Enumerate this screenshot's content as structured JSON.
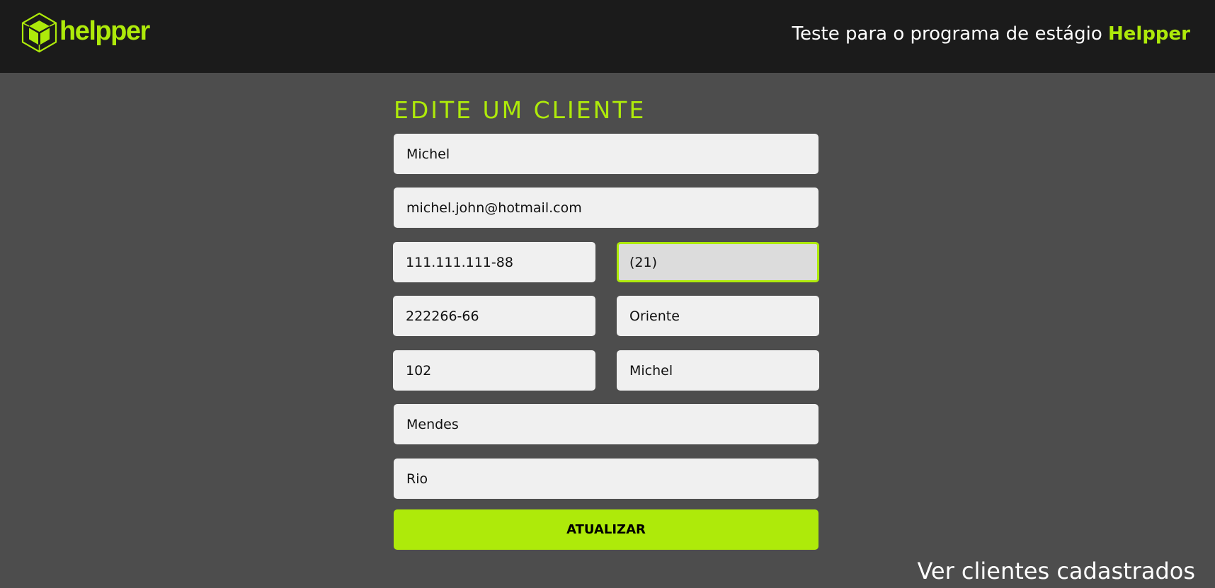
{
  "header": {
    "logo_text": "helpper",
    "logo_icon": "cube-icon",
    "tagline_prefix": "Teste para o programa de estágio ",
    "tagline_brand": "Helpper"
  },
  "form": {
    "title": "EDITE UM CLIENTE",
    "fields": {
      "name": "Michel",
      "email": "michel.john@hotmail.com",
      "cpf": "111.111.111-88",
      "phone": "(21)",
      "cep": "222266-66",
      "street": "Oriente",
      "number": "102",
      "neighborhood": "Michel",
      "district": "Mendes",
      "city": "Rio"
    },
    "focused_field": "phone",
    "submit_label": "ATUALIZAR"
  },
  "footer": {
    "view_clients_link": "Ver clientes cadastrados"
  },
  "colors": {
    "accent": "#aeea0a",
    "header_bg": "#1b1b1b",
    "page_bg": "#4d4d4d",
    "field_bg": "#f0f0f0"
  }
}
